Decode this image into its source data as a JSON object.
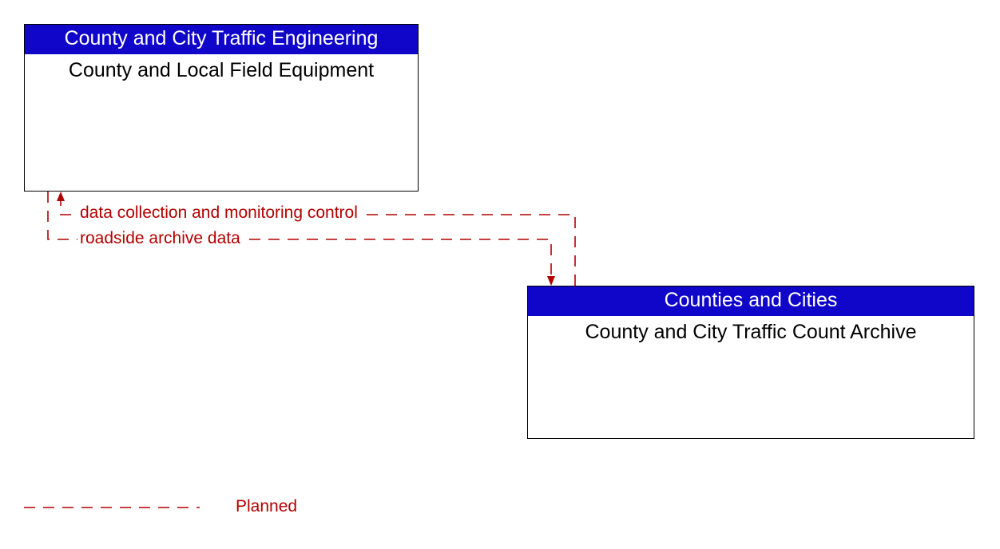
{
  "node_a": {
    "header": "County and City Traffic Engineering",
    "body": "County and Local Field Equipment"
  },
  "node_b": {
    "header": "Counties and Cities",
    "body": "County and City Traffic Count Archive"
  },
  "flows": {
    "to_a": "data collection and monitoring control",
    "to_b": "roadside archive data"
  },
  "legend": {
    "planned": "Planned"
  }
}
